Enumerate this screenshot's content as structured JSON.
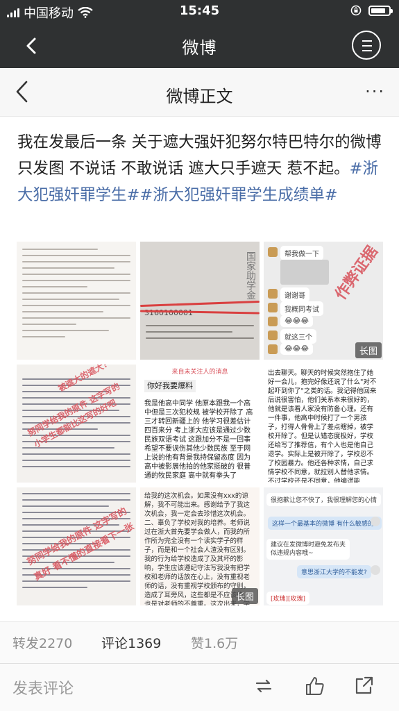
{
  "status_bar": {
    "carrier": "中国移动",
    "time": "15:45",
    "battery_percent": 85
  },
  "app_header": {
    "title": "微博"
  },
  "weibo_header": {
    "title": "微博正文",
    "more_label": "···"
  },
  "post": {
    "text": "我在发最后一条 关于遮大强奸犯努尔特巴特尔的微博 只发图 不说话 不敢说话 遮大只手遮天 惹不起。",
    "hashtag_1": "#浙大犯强奸罪学生#",
    "hashtag_2": "#浙大犯强奸罪学生成绩单#"
  },
  "images": {
    "badge_long": "长图",
    "img2_watermark": "国家助学金",
    "img2_number": "3160100001",
    "img3_stamp": "作弊证据",
    "img3_chats": [
      "帮我做一下",
      "谢谢哥",
      "我概同考试",
      "😂😂😂",
      "就这三个",
      "😂😂😂"
    ],
    "img4_stamp_1": "被遮大的遮大?",
    "img4_stamp_2": "努同学给我的原件 这字写的",
    "img4_stamp_3": "小学生都能比这写的好吧",
    "img5_header": "来自未关注人的消息",
    "img5_greeting": "你好我要爆料",
    "img5_body": "我是他高中同学 他原本跟我一个高中但是三次犯校规 被学校开除了 高三才转回新疆上的 他学习很差估计四百来分 考上浙大应该是通过少数民族双语考试 这跟加分不是一回事 希望不要误伤其他少数民族 至于网上说的他有背景我持保留态度 因为高中被影展他拍的他家挺破的 很普通的牧民家庭 高中就有拳头了",
    "img6_body": "出去聊天。聊天的时候突然抱住了她好一会儿，抱完好像还说了什么\"对不起吓到你了\"之类的话。我记得他回来后说很害怕，他们关系本来很好的，他就是该看人家没有防备心理。还有一件事，他高中时候打了一个男孩子，打得人骨骨上了差点瞎掉，被学校开除了。但是认错态度极好，学校还给写了推荐信，有个人也是他自己退学。实际上是被开除了，学校忍不了校园暴力。他还各种求情，自己求情学校不同意，就拉别人替他求情。不过学校还是不同意，他编谎能",
    "img7_stamp_1": "努同学给我的原件 这字写的",
    "img7_stamp_2": "真好 看不懂的直接看下一张",
    "img8_body": "给我的这次机会。如果没有xxx的谅解，我不可能出来。感谢给予了我这次机会，我一定会去珍惜这次机会。二、辜负了学校对我的培养。老师说过在浙大首先要学会做人，而我的所作所为完全没有一个读实学子的样子，而是和一个社会人渣没有区别。我的行为给学校造成了及其坏的影响，学生应该遵纪守法写我没有把学校和老师的话放在心上，没有重视老师的话，没有重视学校颁布的守则，造成了耳旁风，这些都是不应该的，也是对老师的不尊重。这次出来，学院帮助了我很多，从案发当日至今，学院领导和辅导员，因为我操心。为了我做了很多事，如果没有",
    "img9_chats": [
      "很抱歉让您不快了，我很理解您的心情",
      "这样一个最基本的微博 有什么敏感的?",
      "建议在发微博时避免发布夹似违规内容哦~",
      "意思浙江大学的不能发?"
    ],
    "img9_footer": "[玫瑰][玫瑰]"
  },
  "stats": {
    "reposts": "转发2270",
    "comments": "评论1369",
    "likes": "赞1.6万"
  },
  "bottom_bar": {
    "comment_placeholder": "发表评论"
  },
  "colors": {
    "header_bg": "#2f3132",
    "hashtag": "#4a6da7",
    "stamp_red": "#d8505a"
  }
}
